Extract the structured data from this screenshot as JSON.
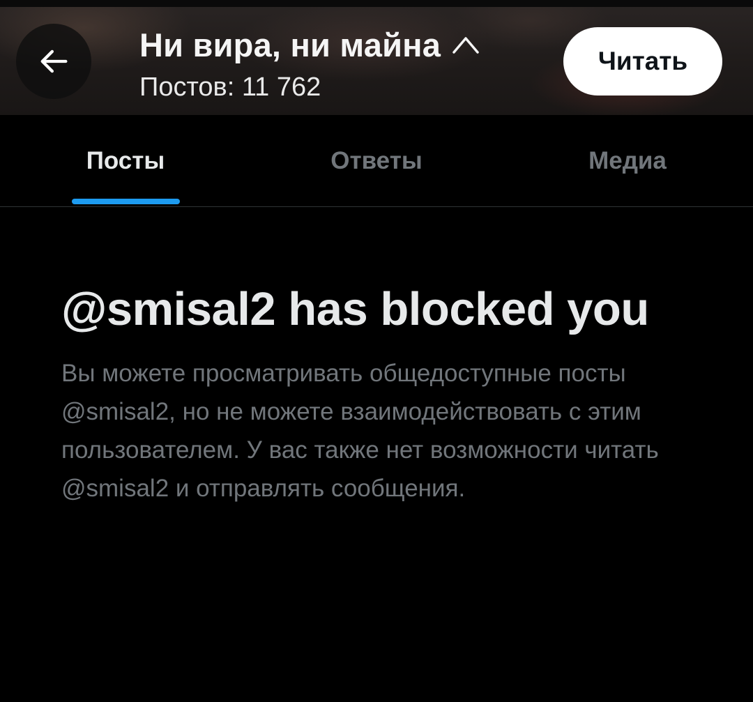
{
  "header": {
    "title": "Ни вира, ни майна",
    "subtitle": "Постов: 11 762",
    "back_icon": "arrow-left-icon",
    "title_icon": "chevron-up-icon",
    "follow_label": "Читать"
  },
  "tabs": [
    {
      "label": "Посты",
      "active": true
    },
    {
      "label": "Ответы",
      "active": false
    },
    {
      "label": "Медиа",
      "active": false
    }
  ],
  "blocked": {
    "title": "@smisal2 has blocked you",
    "text": "Вы можете просматривать общедоступные посты @smisal2, но не можете взаимодействовать с этим пользователем. У вас также нет возможности читать @smisal2 и отправлять сообщения."
  },
  "colors": {
    "background": "#000000",
    "accent": "#1d9bf0",
    "primary_text": "#e7e9ea",
    "secondary_text": "#71767b",
    "button_bg": "#ffffff"
  }
}
